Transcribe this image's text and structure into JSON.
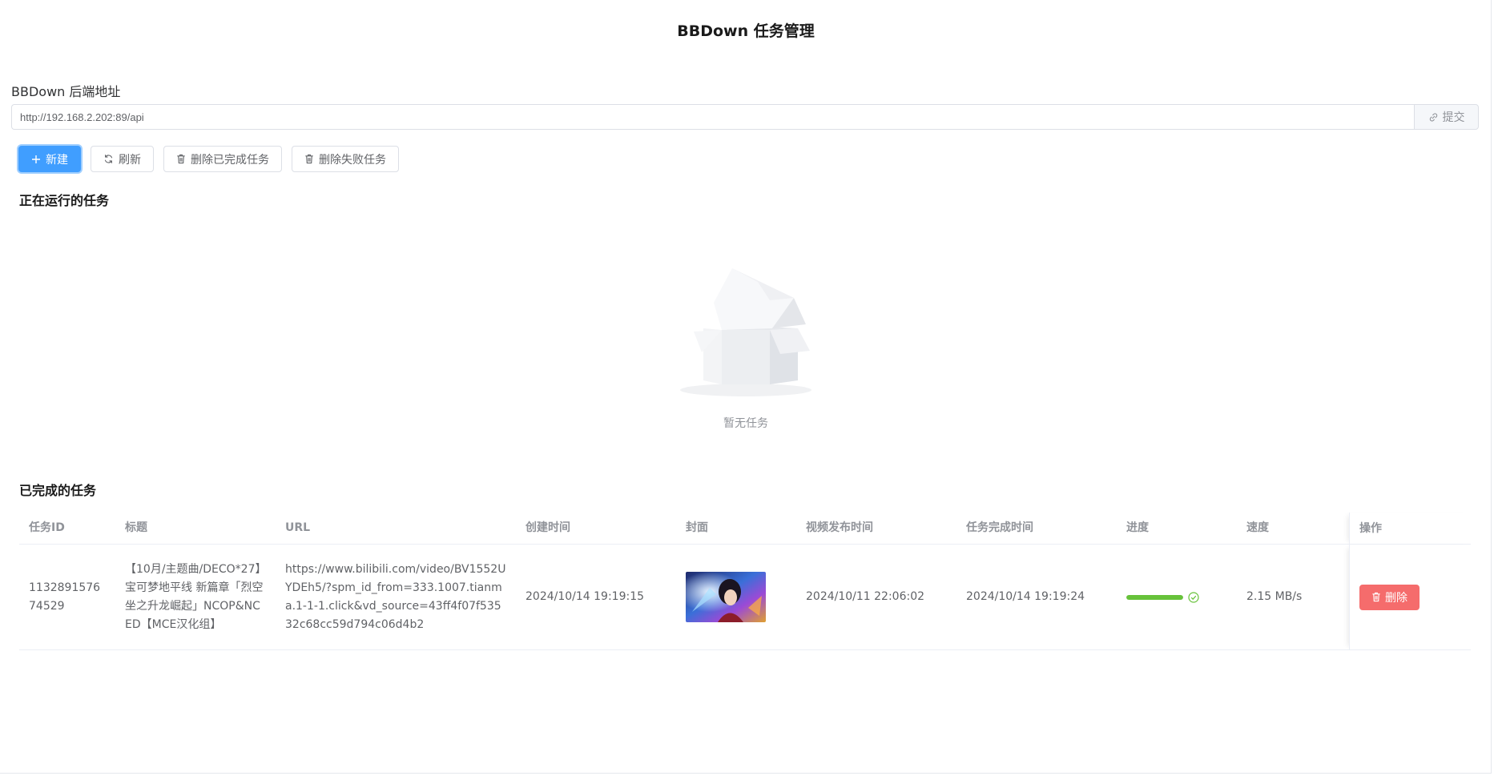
{
  "page": {
    "title": "BBDown 任务管理"
  },
  "backend": {
    "label": "BBDown 后端地址",
    "url_value": "http://192.168.2.202:89/api",
    "submit_label": "提交"
  },
  "toolbar": {
    "new_label": "新建",
    "refresh_label": "刷新",
    "delete_completed_label": "删除已完成任务",
    "delete_failed_label": "删除失败任务"
  },
  "running": {
    "title": "正在运行的任务",
    "empty_text": "暂无任务"
  },
  "completed": {
    "title": "已完成的任务",
    "columns": {
      "id": "任务ID",
      "title": "标题",
      "url": "URL",
      "created": "创建时间",
      "cover": "封面",
      "published": "视频发布时间",
      "finished": "任务完成时间",
      "progress": "进度",
      "speed": "速度",
      "actions": "操作"
    },
    "rows": [
      {
        "id": "113289157674529",
        "title": "【10月/主题曲/DECO*27】宝可梦地平线 新篇章「烈空坐之升龙崛起」NCOP&NCED【MCE汉化组】",
        "url": "https://www.bilibili.com/video/BV1552UYDEh5/?spm_id_from=333.1007.tianma.1-1-1.click&vd_source=43ff4f07f53532c68cc59d794c06d4b2",
        "created": "2024/10/14 19:19:15",
        "published": "2024/10/11 22:06:02",
        "finished": "2024/10/14 19:19:24",
        "progress_percent": 100,
        "speed": "2.15 MB/s",
        "delete_label": "删除"
      }
    ]
  },
  "colors": {
    "primary": "#409eff",
    "success": "#67c23a",
    "danger": "#f56c6c"
  }
}
